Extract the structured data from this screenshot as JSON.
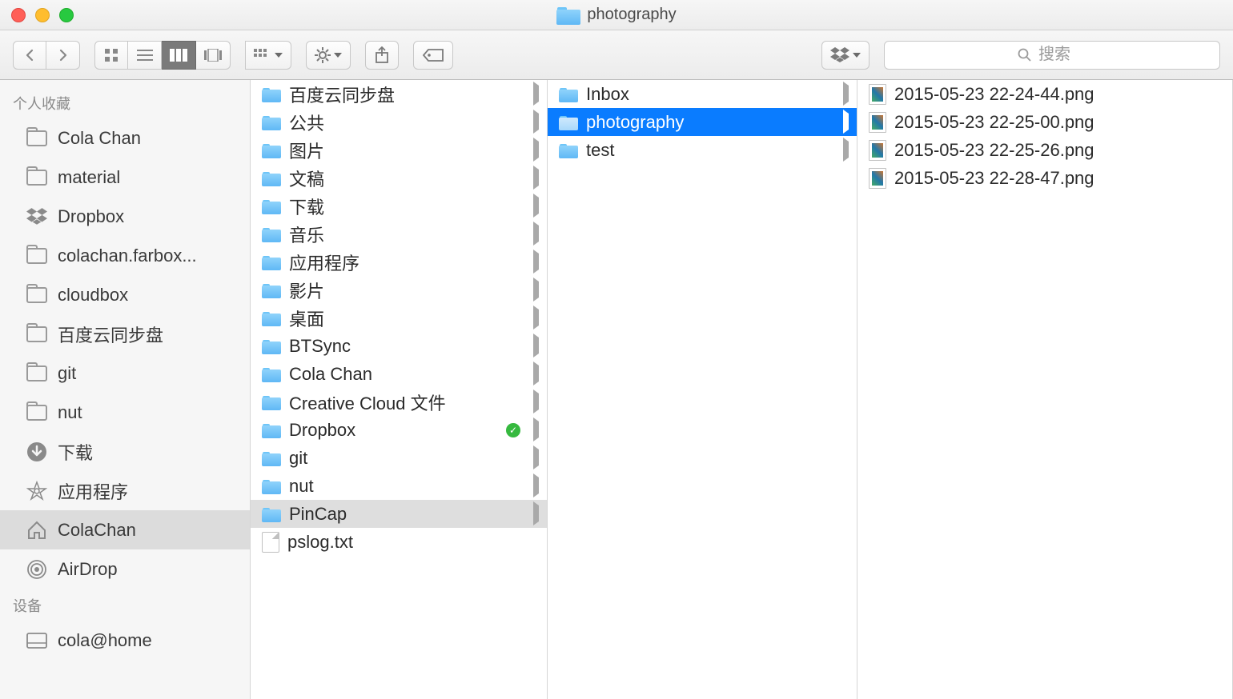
{
  "window": {
    "title": "photography"
  },
  "toolbar": {
    "search_placeholder": "搜索"
  },
  "sidebar": {
    "sections": [
      {
        "title": "个人收藏",
        "items": [
          {
            "label": "Cola Chan",
            "icon": "folder"
          },
          {
            "label": "material",
            "icon": "folder"
          },
          {
            "label": "Dropbox",
            "icon": "dropbox"
          },
          {
            "label": "colachan.farbox...",
            "icon": "folder"
          },
          {
            "label": "cloudbox",
            "icon": "folder"
          },
          {
            "label": "百度云同步盘",
            "icon": "folder"
          },
          {
            "label": "git",
            "icon": "folder"
          },
          {
            "label": "nut",
            "icon": "folder"
          },
          {
            "label": "下载",
            "icon": "download"
          },
          {
            "label": "应用程序",
            "icon": "apps"
          },
          {
            "label": "ColaChan",
            "icon": "home",
            "selected": true
          },
          {
            "label": "AirDrop",
            "icon": "airdrop"
          }
        ]
      },
      {
        "title": "设备",
        "items": [
          {
            "label": "cola@home",
            "icon": "disk"
          }
        ]
      }
    ]
  },
  "columns": [
    {
      "items": [
        {
          "label": "百度云同步盘",
          "type": "folder",
          "arrow": true
        },
        {
          "label": "公共",
          "type": "folder",
          "arrow": true
        },
        {
          "label": "图片",
          "type": "folder",
          "arrow": true
        },
        {
          "label": "文稿",
          "type": "folder",
          "arrow": true
        },
        {
          "label": "下载",
          "type": "folder",
          "arrow": true
        },
        {
          "label": "音乐",
          "type": "folder",
          "arrow": true
        },
        {
          "label": "应用程序",
          "type": "folder",
          "arrow": true
        },
        {
          "label": "影片",
          "type": "folder",
          "arrow": true
        },
        {
          "label": "桌面",
          "type": "folder",
          "arrow": true
        },
        {
          "label": "BTSync",
          "type": "folder",
          "arrow": true
        },
        {
          "label": "Cola Chan",
          "type": "folder",
          "arrow": true
        },
        {
          "label": "Creative Cloud 文件",
          "type": "folder",
          "arrow": true
        },
        {
          "label": "Dropbox",
          "type": "folder",
          "arrow": true,
          "badge": "check"
        },
        {
          "label": "git",
          "type": "folder",
          "arrow": true
        },
        {
          "label": "nut",
          "type": "folder",
          "arrow": true
        },
        {
          "label": "PinCap",
          "type": "folder",
          "arrow": true,
          "selected": "grey"
        },
        {
          "label": "pslog.txt",
          "type": "file-txt"
        }
      ]
    },
    {
      "items": [
        {
          "label": "Inbox",
          "type": "folder",
          "arrow": true
        },
        {
          "label": "photography",
          "type": "folder",
          "arrow": true,
          "selected": "blue"
        },
        {
          "label": "test",
          "type": "folder",
          "arrow": true
        }
      ]
    },
    {
      "items": [
        {
          "label": "2015-05-23 22-24-44.png",
          "type": "file-img"
        },
        {
          "label": "2015-05-23 22-25-00.png",
          "type": "file-img"
        },
        {
          "label": "2015-05-23 22-25-26.png",
          "type": "file-img"
        },
        {
          "label": "2015-05-23 22-28-47.png",
          "type": "file-img"
        }
      ]
    }
  ]
}
